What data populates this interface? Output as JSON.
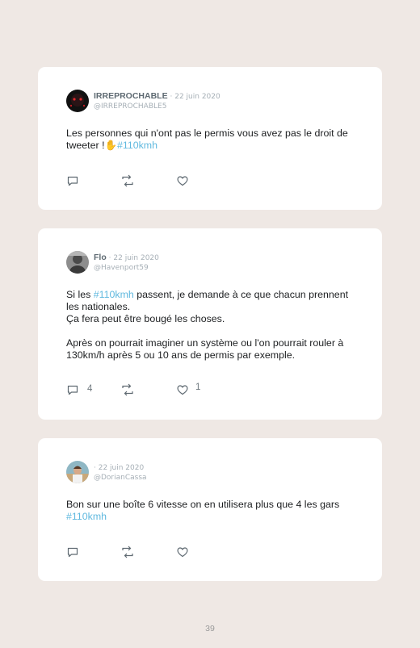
{
  "tweets": [
    {
      "name": "IRREPROCHABLE",
      "date": "· 22 juin 2020",
      "handle": "@IRREPROCHABLE5",
      "text_a": "Les personnes qui n'ont pas le permis vous avez pas le droit de tweeter !",
      "emoji": "✋",
      "hashtag": "#110kmh",
      "reply_count": "",
      "like_count": ""
    },
    {
      "name": "Flo",
      "date": "· 22 juin 2020",
      "handle": "@Havenport59",
      "text_pre": "Si les ",
      "hashtag": "#110kmh",
      "text_post": " passent, je demande à ce que chacun prennent les nationales.",
      "line2": "Ça fera peut être bougé les choses.",
      "line3": "Après on pourrait imaginer un système ou l'on pourrait rouler à 130km/h après 5 ou 10 ans de permis par exemple.",
      "reply_count": "4",
      "like_count": "1"
    },
    {
      "name": "",
      "date": "· 22 juin 2020",
      "handle": "@DorianCassa",
      "text_a": "Bon sur une boîte 6 vitesse on en utilisera plus que 4 les gars ",
      "hashtag": "#110kmh",
      "reply_count": "",
      "like_count": ""
    }
  ],
  "page_number": "39",
  "colors": {
    "background": "#efe8e4",
    "card": "#ffffff",
    "hashtag": "#60b9df",
    "icon": "#5f6a72"
  },
  "icons": [
    "reply-icon",
    "retweet-icon",
    "like-icon"
  ]
}
